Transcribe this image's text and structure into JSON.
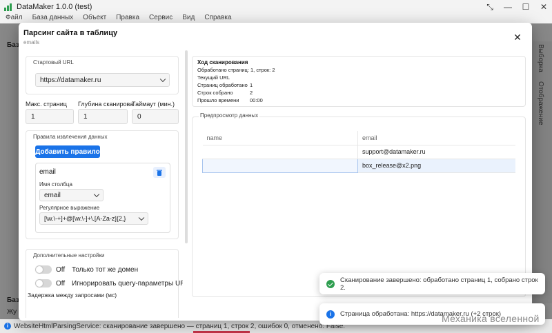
{
  "app": {
    "title": "DataMaker 1.0.0 (test)",
    "menu": [
      "Файл",
      "База данных",
      "Объект",
      "Правка",
      "Сервис",
      "Вид",
      "Справка"
    ],
    "window_controls": [
      "⤡",
      "—",
      "☐",
      "✕"
    ],
    "bg_labels": [
      "Баз",
      "Баз",
      "Жу"
    ],
    "right_tabs": [
      "Выборка",
      "Отображение"
    ]
  },
  "status_bar": {
    "text": "WebsiteHtmlParsingService: сканирование завершено — страниц 1, строк 2, ошибок 0, отменено: False."
  },
  "dialog": {
    "title": "Парсинг сайта в таблицу",
    "subtitle": "emails",
    "close_glyph": "✕",
    "start_url": {
      "label": "Стартовый URL",
      "value": "https://datamaker.ru"
    },
    "limits": {
      "max_pages": {
        "label": "Макс. страниц",
        "value": "1"
      },
      "depth": {
        "label": "Глубина сканирова",
        "value": "1"
      },
      "timeout": {
        "label": "Таймаут (мин.)",
        "value": "0"
      }
    },
    "rules": {
      "label": "Правила извлечения данных",
      "add_button": "Добавить правило",
      "rule": {
        "name": "email",
        "column_label": "Имя столбца",
        "column_value": "email",
        "regex_label": "Регулярное выражение",
        "regex_value": "[\\w.\\-+]+@[\\w.\\-]+\\.[A-Za-z]{2,}"
      }
    },
    "extra": {
      "label": "Дополнительные настройки",
      "same_domain": {
        "state": "Off",
        "text": "Только тот же домен"
      },
      "ignore_query": {
        "state": "Off",
        "text": "Игнорировать query-параметры URL"
      },
      "delay_label": "Задержка между запросами (мс)"
    },
    "progress": {
      "title": "Ход сканирования",
      "processed_line": "Обработано страниц: 1, строк: 2",
      "current_url_label": "Текущий URL",
      "rows": [
        {
          "k": "Страниц обработано",
          "v": "1"
        },
        {
          "k": "Строк собрано",
          "v": "2"
        },
        {
          "k": "Прошло времени",
          "v": "00:00"
        }
      ]
    },
    "preview": {
      "label": "Предпросмотр данных",
      "columns": [
        "name",
        "email"
      ],
      "rows": [
        [
          "",
          "support@datamaker.ru"
        ],
        [
          "",
          "box_release@x2.png"
        ]
      ]
    }
  },
  "toasts": {
    "success": "Сканирование завершено: обработано страниц 1, собрано строк 2.",
    "info": "Страница обработана: https://datamaker.ru (+2 строк)"
  },
  "watermark": "Механика вселенной",
  "colors": {
    "primary": "#1a73e8",
    "success": "#2e9e4f",
    "overlay": "rgba(0,0,0,0.45)"
  }
}
